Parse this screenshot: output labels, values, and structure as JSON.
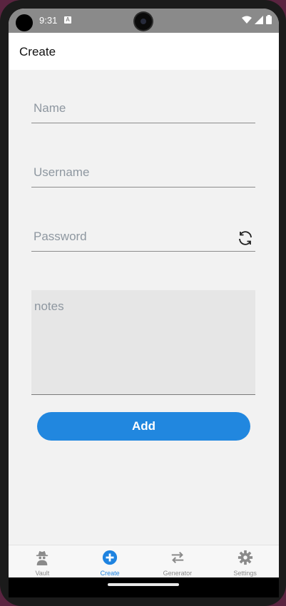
{
  "status_bar": {
    "time": "9:31",
    "notification_icon": "A"
  },
  "app_bar": {
    "title": "Create"
  },
  "form": {
    "name_placeholder": "Name",
    "username_placeholder": "Username",
    "password_placeholder": "Password",
    "notes_placeholder": "notes",
    "add_label": "Add"
  },
  "tabs": [
    {
      "label": "Vault",
      "icon": "spy-icon",
      "active": false
    },
    {
      "label": "Create",
      "icon": "plus-circle-icon",
      "active": true
    },
    {
      "label": "Generator",
      "icon": "swap-arrows-icon",
      "active": false
    },
    {
      "label": "Settings",
      "icon": "gear-icon",
      "active": false
    }
  ],
  "colors": {
    "accent": "#2187df",
    "active_tab": "#1e83e0",
    "inactive_tab": "#8a8a8a"
  }
}
